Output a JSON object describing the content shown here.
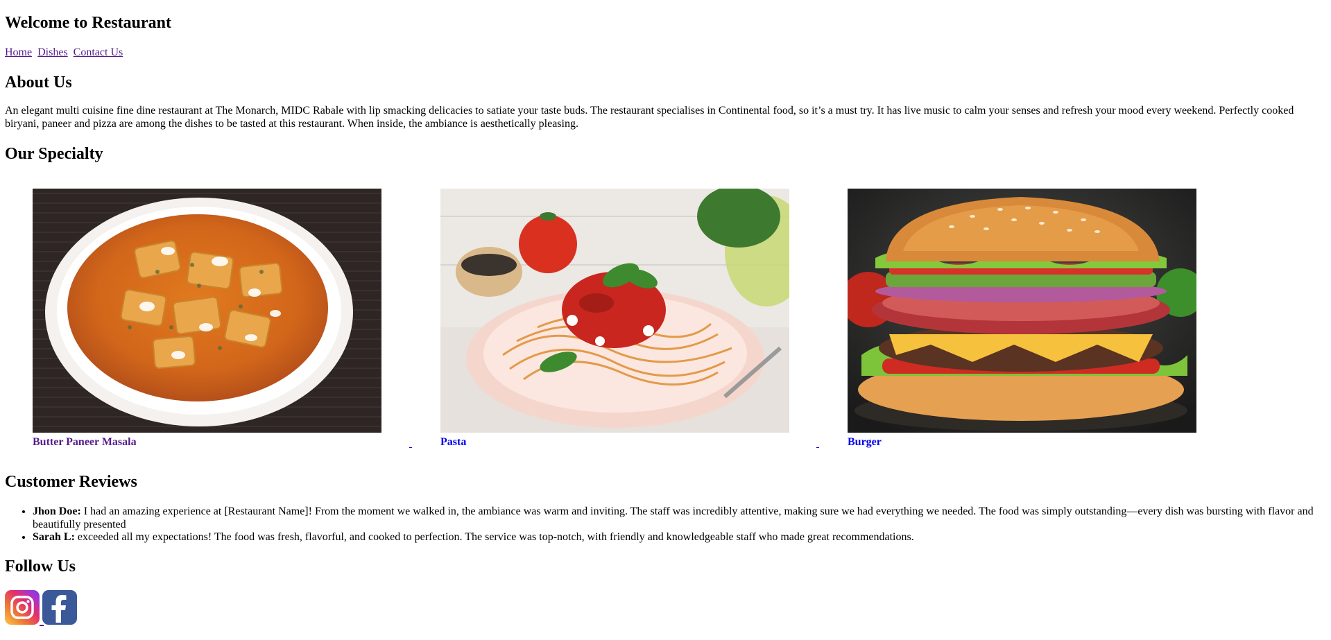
{
  "header": {
    "title": "Welcome to Restaurant"
  },
  "nav": {
    "items": [
      "Home",
      "Dishes",
      "Contact Us"
    ]
  },
  "about": {
    "title": "About Us",
    "text": "An elegant multi cuisine fine dine restaurant at The Monarch, MIDC Rabale with lip smacking delicacies to satiate your taste buds. The restaurant specialises in Continental food, so it’s a must try. It has live music to calm your senses and refresh your mood every weekend. Perfectly cooked biryani, paneer and pizza are among the dishes to be tasted at this restaurant. When inside, the ambiance is aesthetically pleasing."
  },
  "specialty": {
    "title": "Our Specialty",
    "dishes": [
      {
        "name": "Butter Paneer Masala",
        "image": "butter-paneer-masala-photo"
      },
      {
        "name": "Pasta",
        "image": "spaghetti-pasta-photo"
      },
      {
        "name": "Burger",
        "image": "cheeseburger-photo"
      }
    ]
  },
  "reviews": {
    "title": "Customer Reviews",
    "items": [
      {
        "author": "Jhon Doe:",
        "text": "I had an amazing experience at [Restaurant Name]! From the moment we walked in, the ambiance was warm and inviting. The staff was incredibly attentive, making sure we had everything we needed. The food was simply outstanding—every dish was bursting with flavor and beautifully presented"
      },
      {
        "author": "Sarah L:",
        "text": "exceeded all my expectations! The food was fresh, flavorful, and cooked to perfection. The service was top-notch, with friendly and knowledgeable staff who made great recommendations."
      }
    ]
  },
  "follow": {
    "title": "Follow Us",
    "icons": [
      "instagram-icon",
      "facebook-icon"
    ]
  },
  "colors": {
    "link_visited": "#551a8b",
    "link_unvisited": "#0000ee",
    "facebook": "#3b5998"
  }
}
